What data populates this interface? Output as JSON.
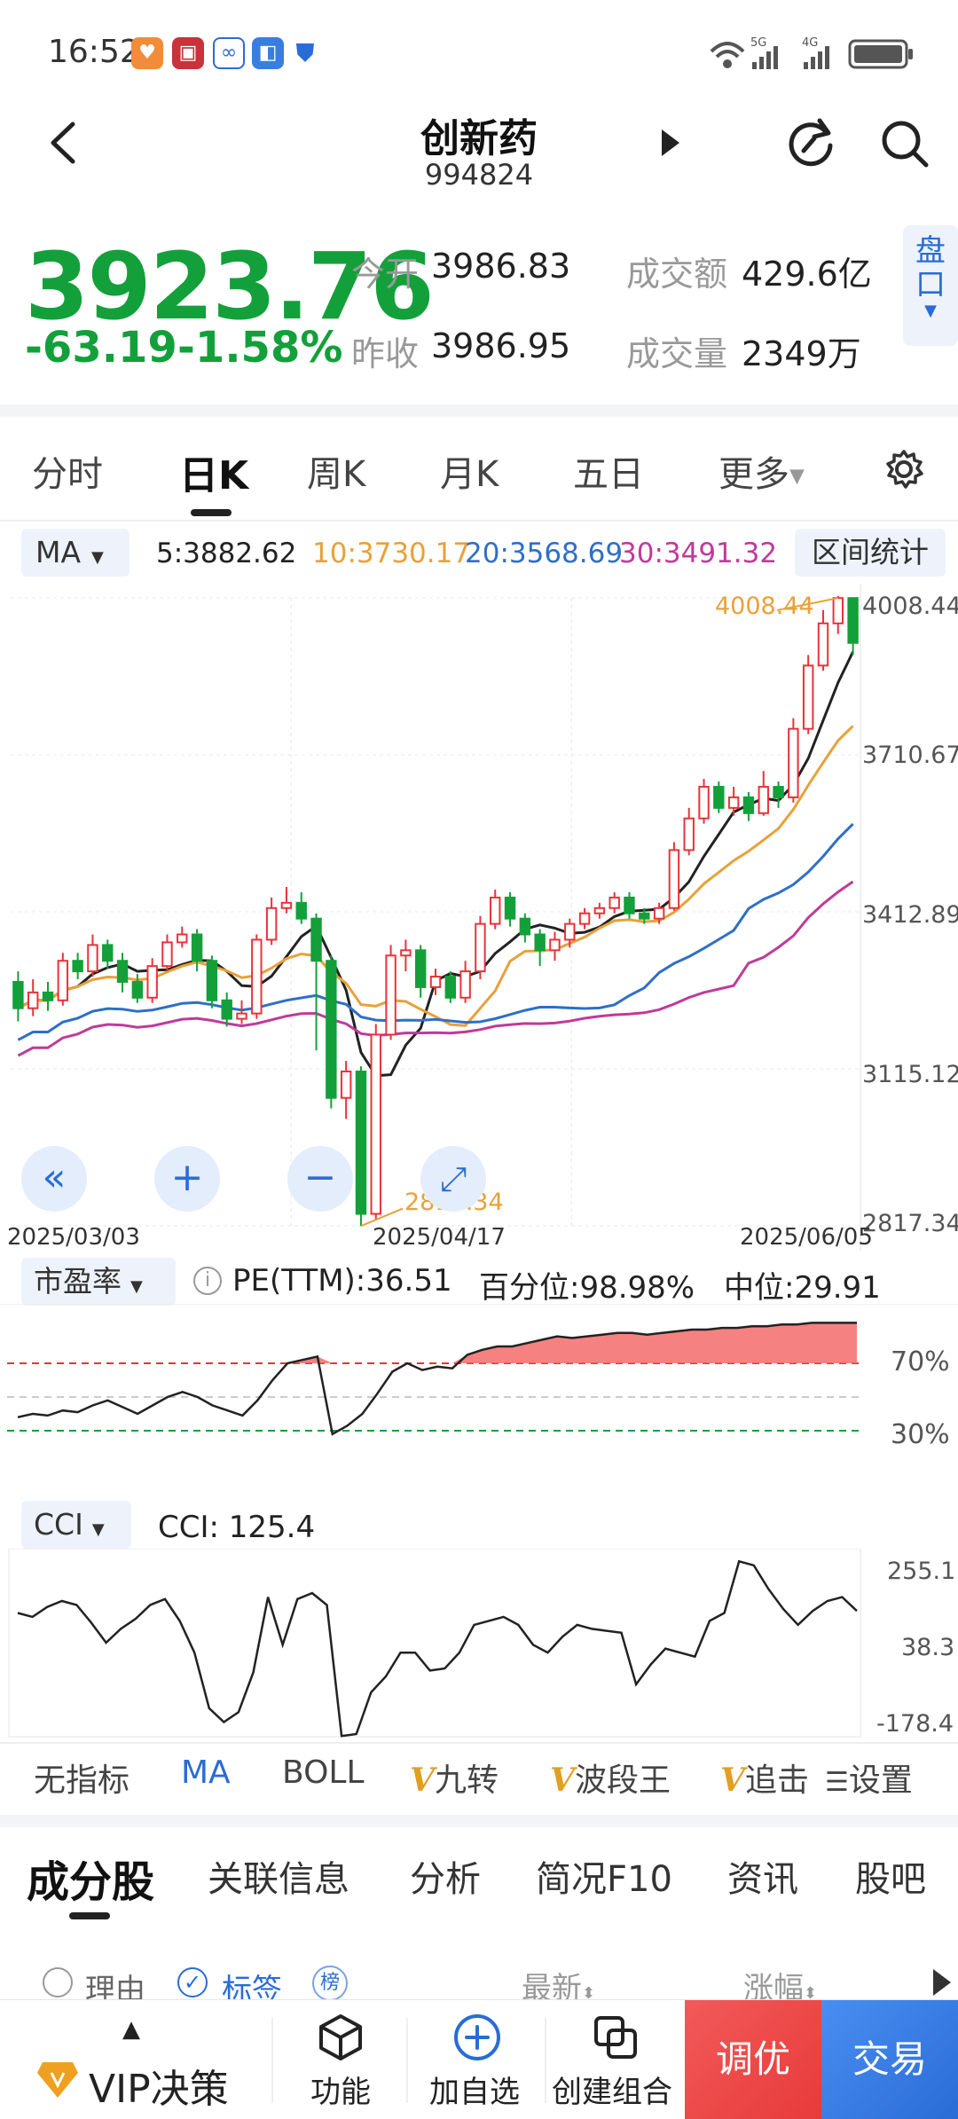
{
  "status_bar": {
    "time": "16:52",
    "network_labels": [
      "5G",
      "4G"
    ]
  },
  "header": {
    "title": "创新药",
    "code": "994824"
  },
  "quote": {
    "price": "3923.76",
    "change": "-63.19",
    "change_pct": "-1.58%",
    "open_label": "今开",
    "open": "3986.83",
    "prev_close_label": "昨收",
    "prev_close": "3986.95",
    "amount_label": "成交额",
    "amount": "429.6亿",
    "volume_label": "成交量",
    "volume": "2349万",
    "pankou_label_1": "盘",
    "pankou_label_2": "口"
  },
  "colors": {
    "up": "#e8333a",
    "down": "#13a03a",
    "ma5": "#222222",
    "ma10": "#e8a13a",
    "ma20": "#2e6fc8",
    "ma30": "#c03a9a",
    "accent": "#2a6cd6"
  },
  "period_tabs": [
    {
      "label": "分时"
    },
    {
      "label": "日K",
      "active": true
    },
    {
      "label": "周K"
    },
    {
      "label": "月K"
    },
    {
      "label": "五日"
    },
    {
      "label": "更多"
    }
  ],
  "ma_bar": {
    "selector": "MA",
    "ma5": "5:3882.62",
    "ma10": "10:3730.17",
    "ma20": "20:3568.69",
    "ma30": "30:3491.32",
    "range_stats": "区间统计"
  },
  "kline": {
    "y_ticks": [
      "4008.44",
      "3710.67",
      "3412.89",
      "3115.12",
      "2817.34"
    ],
    "high_label": "4008.44",
    "low_label": "2817.34",
    "dates": [
      "2025/03/03",
      "2025/04/17",
      "2025/06/05"
    ]
  },
  "pe_panel": {
    "selector": "市盈率",
    "pe": "PE(TTM):36.51",
    "percentile": "百分位:98.98%",
    "median": "中位:29.91",
    "level_high": "70%",
    "level_low": "30%"
  },
  "cci_panel": {
    "selector": "CCI",
    "value": "CCI:  125.4",
    "y_ticks": [
      "255.1",
      "38.3",
      "-178.4"
    ]
  },
  "indicator_tabs": {
    "none": "无指标",
    "ma": "MA",
    "boll": "BOLL",
    "v1": "九转",
    "v2": "波段王",
    "v3": "追击",
    "settings": "设置",
    "v_mark": "V"
  },
  "section_tabs": [
    {
      "label": "成分股",
      "active": true
    },
    {
      "label": "关联信息"
    },
    {
      "label": "分析"
    },
    {
      "label": "简况F10"
    },
    {
      "label": "资讯"
    },
    {
      "label": "股吧"
    }
  ],
  "list_header": {
    "reason": "理由",
    "tags": "标签",
    "rank": "榜",
    "latest": "最新",
    "change": "涨幅"
  },
  "bottom_bar": {
    "vip": "VIP决策",
    "function": "功能",
    "add_watch": "加自选",
    "create_combo": "创建组合",
    "optimize": "调优",
    "trade": "交易"
  },
  "chart_data": [
    {
      "type": "candlestick",
      "title": "",
      "x_range": [
        "2025/03/03",
        "2025/06/05"
      ],
      "ylim": [
        2817.34,
        4008.44
      ],
      "y_ticks": [
        4008.44,
        3710.67,
        3412.89,
        3115.12,
        2817.34
      ],
      "candles": [
        [
          3280,
          3230,
          3300,
          3205
        ],
        [
          3230,
          3260,
          3285,
          3215
        ],
        [
          3260,
          3245,
          3280,
          3225
        ],
        [
          3245,
          3320,
          3335,
          3235
        ],
        [
          3320,
          3300,
          3335,
          3285
        ],
        [
          3300,
          3350,
          3370,
          3290
        ],
        [
          3350,
          3320,
          3360,
          3305
        ],
        [
          3320,
          3280,
          3335,
          3260
        ],
        [
          3280,
          3250,
          3295,
          3240
        ],
        [
          3250,
          3310,
          3325,
          3240
        ],
        [
          3310,
          3355,
          3370,
          3300
        ],
        [
          3355,
          3370,
          3385,
          3345
        ],
        [
          3370,
          3320,
          3380,
          3300
        ],
        [
          3320,
          3245,
          3330,
          3230
        ],
        [
          3245,
          3210,
          3260,
          3195
        ],
        [
          3210,
          3220,
          3245,
          3200
        ],
        [
          3220,
          3360,
          3370,
          3210
        ],
        [
          3360,
          3420,
          3440,
          3350
        ],
        [
          3420,
          3430,
          3460,
          3410
        ],
        [
          3430,
          3400,
          3450,
          3390
        ],
        [
          3400,
          3320,
          3410,
          3150
        ],
        [
          3320,
          3060,
          3330,
          3040
        ],
        [
          3060,
          3110,
          3130,
          3020
        ],
        [
          3110,
          2840,
          3120,
          2817
        ],
        [
          2840,
          3180,
          3200,
          2830
        ],
        [
          3180,
          3330,
          3350,
          3170
        ],
        [
          3330,
          3340,
          3360,
          3300
        ],
        [
          3340,
          3270,
          3350,
          3250
        ],
        [
          3270,
          3290,
          3305,
          3255
        ],
        [
          3290,
          3250,
          3300,
          3240
        ],
        [
          3250,
          3300,
          3320,
          3240
        ],
        [
          3300,
          3390,
          3405,
          3285
        ],
        [
          3390,
          3440,
          3455,
          3380
        ],
        [
          3440,
          3400,
          3450,
          3385
        ],
        [
          3400,
          3370,
          3410,
          3355
        ],
        [
          3370,
          3340,
          3380,
          3310
        ],
        [
          3340,
          3360,
          3375,
          3320
        ],
        [
          3360,
          3390,
          3400,
          3345
        ],
        [
          3390,
          3410,
          3420,
          3380
        ],
        [
          3410,
          3420,
          3430,
          3400
        ],
        [
          3420,
          3440,
          3450,
          3410
        ],
        [
          3440,
          3410,
          3450,
          3400
        ],
        [
          3410,
          3400,
          3420,
          3390
        ],
        [
          3400,
          3420,
          3430,
          3390
        ],
        [
          3420,
          3530,
          3545,
          3415
        ],
        [
          3530,
          3590,
          3610,
          3520
        ],
        [
          3590,
          3650,
          3665,
          3580
        ],
        [
          3650,
          3610,
          3660,
          3600
        ],
        [
          3610,
          3630,
          3650,
          3595
        ],
        [
          3630,
          3600,
          3640,
          3585
        ],
        [
          3600,
          3650,
          3680,
          3595
        ],
        [
          3650,
          3630,
          3660,
          3610
        ],
        [
          3630,
          3760,
          3780,
          3620
        ],
        [
          3760,
          3880,
          3900,
          3750
        ],
        [
          3880,
          3960,
          3985,
          3870
        ],
        [
          3960,
          4008,
          4012,
          3940
        ],
        [
          4008,
          3923,
          4008,
          3900
        ]
      ],
      "series": [
        {
          "name": "5",
          "last": 3882.62
        },
        {
          "name": "10",
          "last": 3730.17
        },
        {
          "name": "20",
          "last": 3568.69
        },
        {
          "name": "30",
          "last": 3491.32
        }
      ]
    },
    {
      "type": "area",
      "title": "",
      "ylim": [
        0,
        100
      ],
      "values": [
        38,
        40,
        39,
        42,
        41,
        45,
        48,
        44,
        40,
        45,
        50,
        53,
        50,
        45,
        42,
        39,
        48,
        60,
        70,
        72,
        74,
        28,
        33,
        40,
        52,
        65,
        70,
        66,
        68,
        67,
        75,
        78,
        80,
        80,
        82,
        84,
        86,
        85,
        86,
        87,
        88,
        88,
        87,
        88,
        89,
        90,
        90,
        91,
        91,
        92,
        92,
        93,
        93,
        94,
        94,
        94,
        94
      ],
      "thresholds": [
        70,
        30
      ]
    },
    {
      "type": "line",
      "title": "",
      "ylim": [
        -178.4,
        255.1
      ],
      "y_ticks": [
        255.1,
        38.3,
        -178.4
      ],
      "values": [
        120,
        110,
        135,
        150,
        140,
        95,
        45,
        80,
        105,
        140,
        155,
        100,
        20,
        -120,
        -155,
        -130,
        -30,
        160,
        40,
        155,
        170,
        140,
        -190,
        -185,
        -80,
        -40,
        20,
        20,
        -25,
        -20,
        20,
        90,
        100,
        110,
        90,
        40,
        20,
        60,
        90,
        80,
        75,
        70,
        -60,
        -10,
        30,
        20,
        10,
        100,
        120,
        250,
        240,
        180,
        130,
        90,
        125,
        150,
        160,
        125
      ]
    }
  ]
}
